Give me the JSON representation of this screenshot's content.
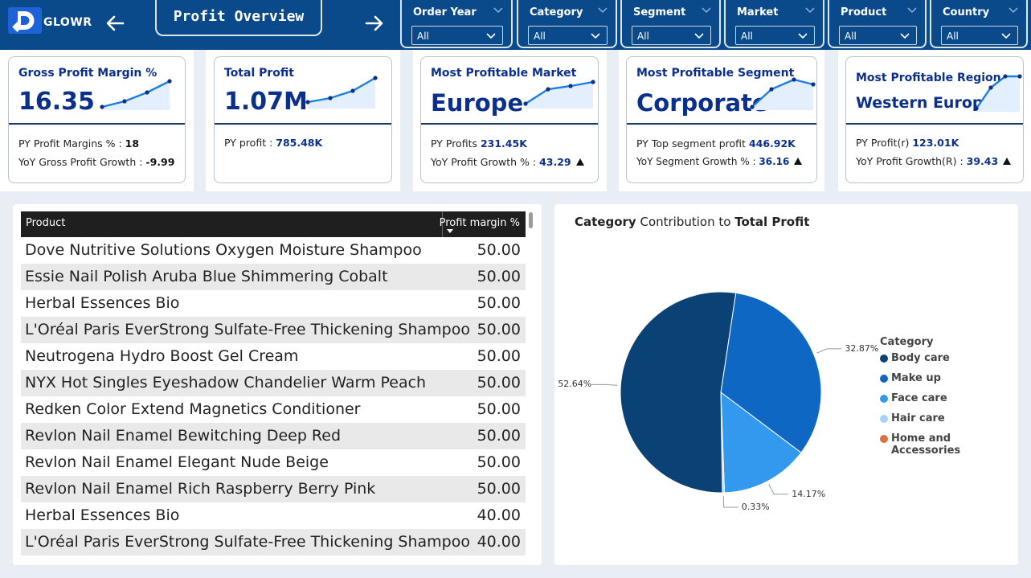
{
  "app": {
    "logo_text": "GLOWR",
    "title": "Profit Overview"
  },
  "filters": [
    {
      "label": "Order Year",
      "value": "All"
    },
    {
      "label": "Category",
      "value": "All"
    },
    {
      "label": "Segment",
      "value": "All"
    },
    {
      "label": "Market",
      "value": "All"
    },
    {
      "label": "Product",
      "value": "All"
    },
    {
      "label": "Country",
      "value": "All"
    }
  ],
  "kpis": [
    {
      "title": "Gross Profit Margin %",
      "value": "16.35",
      "line1_label": "PY Profit Margins % : ",
      "line1_value": "18",
      "line2_label": "YoY Gross Profit Growth : ",
      "line2_value": "-9.99"
    },
    {
      "title": "Total Profit",
      "value": "1.07M",
      "line1_label": "PY profit : ",
      "line1_value": "785.48K"
    },
    {
      "title": "Most Profitable Market",
      "value": "Europe",
      "line1_label": "PY Profits ",
      "line1_value": "231.45K",
      "line2_label": "YoY Profit Growth % : ",
      "line2_value": "43.29"
    },
    {
      "title": "Most Profitable Segment",
      "value": "Corporate",
      "line1_label": "PY Top segment profit ",
      "line1_value": "446.92K",
      "line2_label": "YoY Segment Growth % : ",
      "line2_value": "36.16"
    },
    {
      "title": "Most Profitable Region",
      "value": "Western Europe",
      "line1_label": "PY Profit(r) ",
      "line1_value": "123.01K",
      "line2_label": "YoY Profit Growth(R) : ",
      "line2_value": "39.43"
    }
  ],
  "table": {
    "col_product": "Product",
    "col_margin": "Profit margin %",
    "rows": [
      {
        "product": "Dove Nutritive Solutions Oxygen Moisture Shampoo",
        "margin": "50.00"
      },
      {
        "product": "Essie Nail Polish Aruba Blue Shimmering Cobalt",
        "margin": "50.00"
      },
      {
        "product": "Herbal Essences Bio",
        "margin": "50.00"
      },
      {
        "product": "L'Oréal Paris EverStrong Sulfate-Free Thickening Shampoo",
        "margin": "50.00"
      },
      {
        "product": "Neutrogena Hydro Boost Gel Cream",
        "margin": "50.00"
      },
      {
        "product": "NYX Hot Singles Eyeshadow Chandelier Warm Peach",
        "margin": "50.00"
      },
      {
        "product": "Redken Color Extend Magnetics Conditioner",
        "margin": "50.00"
      },
      {
        "product": "Revlon Nail Enamel Bewitching Deep Red",
        "margin": "50.00"
      },
      {
        "product": "Revlon Nail Enamel Elegant Nude Beige",
        "margin": "50.00"
      },
      {
        "product": "Revlon Nail Enamel Rich Raspberry Berry Pink",
        "margin": "50.00"
      },
      {
        "product": "Herbal Essences Bio",
        "margin": "40.00"
      },
      {
        "product": "L'Oréal Paris EverStrong Sulfate-Free Thickening Shampoo",
        "margin": "40.00"
      }
    ]
  },
  "pie": {
    "title_b1": "Category",
    "title_mid": " Contribution to ",
    "title_b2": "Total Profit",
    "legend_title": "Category"
  },
  "chart_data": {
    "type": "pie",
    "title": "Category Contribution to Total Profit",
    "legend_title": "Category",
    "categories": [
      "Body care",
      "Make up",
      "Face care",
      "Hair care",
      "Home and Accessories"
    ],
    "values": [
      52.64,
      32.87,
      14.17,
      0.33,
      0.0
    ],
    "labels": [
      "52.64%",
      "32.87%",
      "14.17%",
      "0.33%",
      ""
    ],
    "colors": [
      "#0b4275",
      "#0f67c4",
      "#3399ee",
      "#a7d2f7",
      "#e0703a"
    ],
    "legend_position": "right"
  }
}
